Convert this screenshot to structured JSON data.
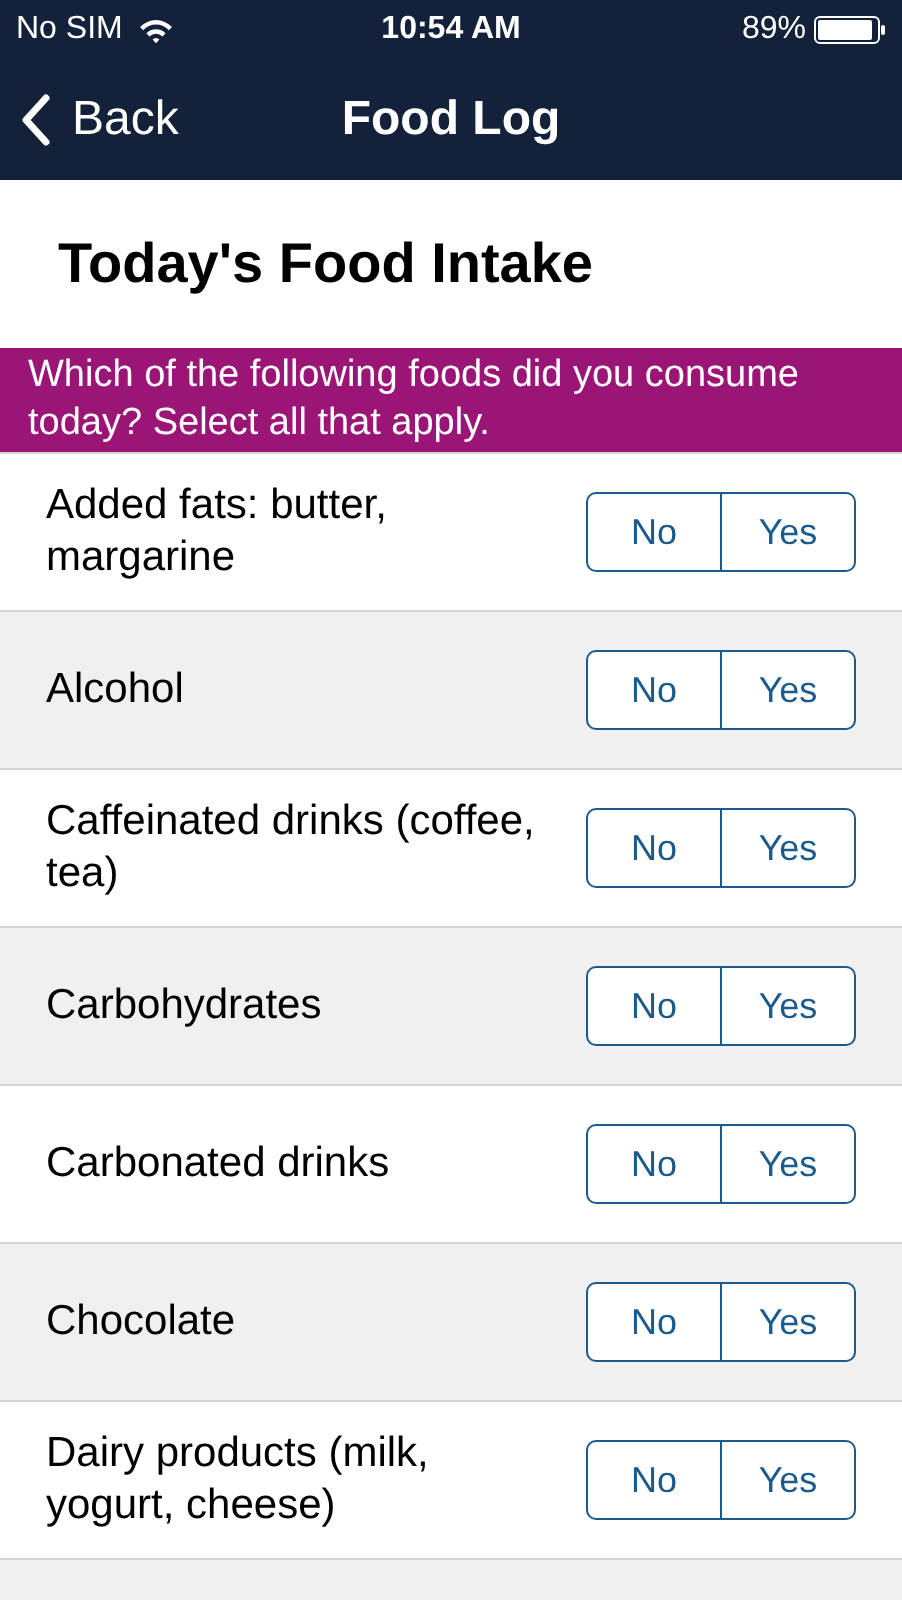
{
  "status_bar": {
    "carrier": "No SIM",
    "time": "10:54 AM",
    "battery": "89%"
  },
  "nav": {
    "back": "Back",
    "title": "Food Log"
  },
  "heading": "Today's Food Intake",
  "instruction": "Which of the following foods did you consume today? Select all that apply.",
  "questions": [
    {
      "kind": "full",
      "label": "Added fats: butter, margarine",
      "options": [
        {
          "label": "No",
          "selected": false
        },
        {
          "label": "Yes",
          "selected": false
        }
      ]
    },
    {
      "kind": "full",
      "label": "Alcohol",
      "options": [
        {
          "label": "No",
          "selected": false
        },
        {
          "label": "Yes",
          "selected": false
        }
      ]
    },
    {
      "kind": "full",
      "label": "Caffeinated drinks (coffee, tea)",
      "options": [
        {
          "label": "No",
          "selected": false
        },
        {
          "label": "Yes",
          "selected": false
        }
      ]
    },
    {
      "kind": "full",
      "label": "Carbohydrates",
      "options": [
        {
          "label": "No",
          "selected": false
        },
        {
          "label": "Yes",
          "selected": false
        }
      ]
    },
    {
      "kind": "full",
      "label": "Carbonated drinks",
      "options": [
        {
          "label": "No",
          "selected": false
        },
        {
          "label": "Yes",
          "selected": false
        }
      ]
    },
    {
      "kind": "full",
      "label": "Chocolate",
      "options": [
        {
          "label": "No",
          "selected": false
        },
        {
          "label": "Yes",
          "selected": false
        }
      ]
    },
    {
      "kind": "full",
      "label": "Dairy products (milk, yogurt, cheese)",
      "options": [
        {
          "label": "No",
          "selected": false
        },
        {
          "label": "Yes",
          "selected": false
        }
      ]
    },
    {
      "kind": "cut_off"
    }
  ]
}
